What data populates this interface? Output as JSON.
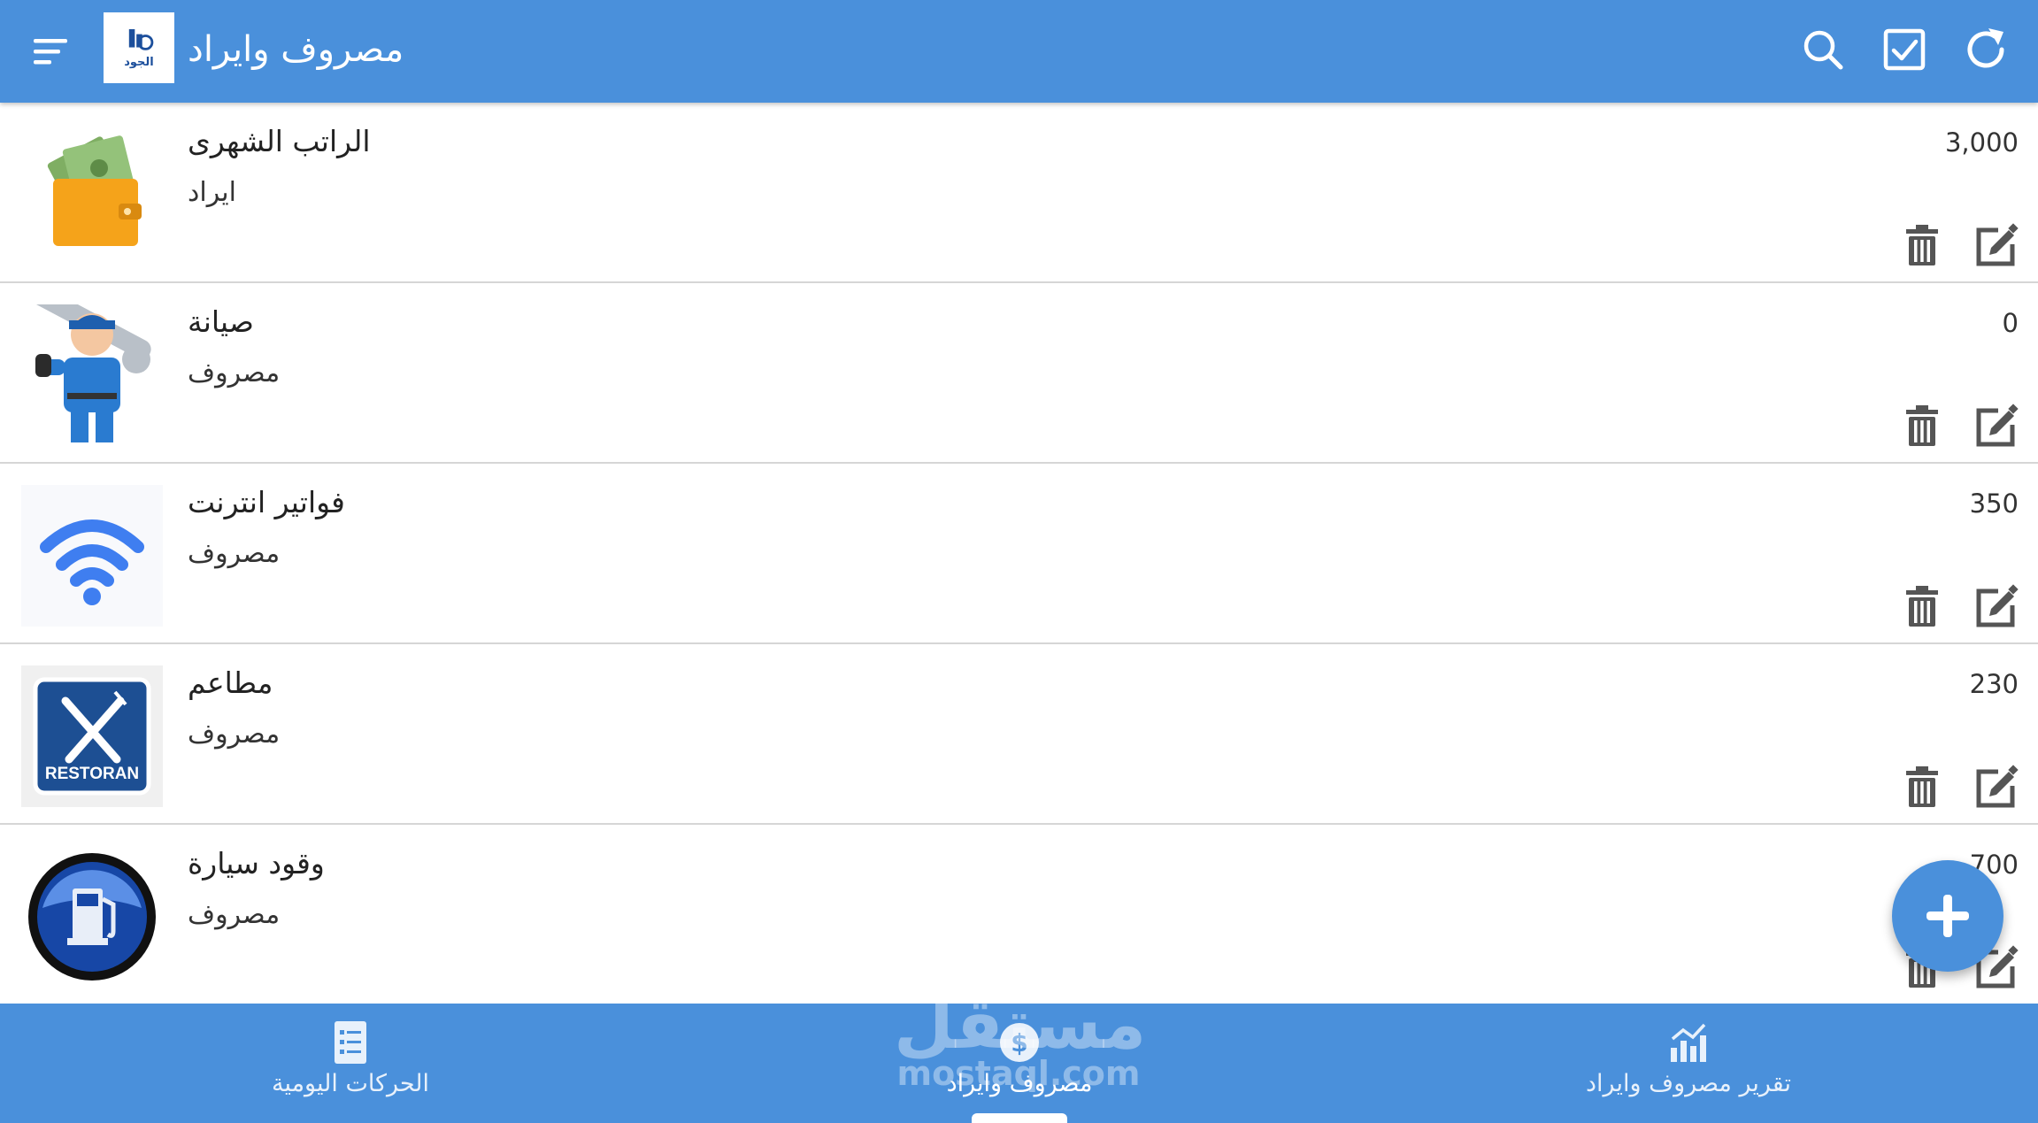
{
  "header": {
    "title": "مصروف وايراد",
    "logo_text": "الجود",
    "icons": {
      "menu": "menu-icon",
      "search": "search-icon",
      "select": "checkbox-icon",
      "refresh": "refresh-icon"
    }
  },
  "items": [
    {
      "name": "الراتب الشهرى",
      "type": "ايراد",
      "amount": "3,000",
      "icon": "wallet-money-image"
    },
    {
      "name": "صيانة",
      "type": "مصروف",
      "amount": "0",
      "icon": "mechanic-image"
    },
    {
      "name": "فواتير انترنت",
      "type": "مصروف",
      "amount": "350",
      "icon": "wifi-image"
    },
    {
      "name": "مطاعم",
      "type": "مصروف",
      "amount": "230",
      "icon": "restaurant-sign-image",
      "image_label": "RESTORAN"
    },
    {
      "name": "وقود سيارة",
      "type": "مصروف",
      "amount": "700",
      "icon": "fuel-pump-image"
    }
  ],
  "row_actions": {
    "delete": "trash-icon",
    "edit": "edit-icon"
  },
  "fab": {
    "icon": "plus-icon"
  },
  "bottom_nav": [
    {
      "label": "الحركات اليومية",
      "icon": "list-icon"
    },
    {
      "label": "مصروف وايراد",
      "icon": "money-icon",
      "active": true
    },
    {
      "label": "تقرير مصروف وايراد",
      "icon": "chart-icon"
    }
  ],
  "watermark": {
    "arabic": "مستقل",
    "latin": "mostaql.com"
  },
  "colors": {
    "primary": "#4a90db",
    "divider": "#d6d6d6",
    "icon_gray": "#555555"
  }
}
